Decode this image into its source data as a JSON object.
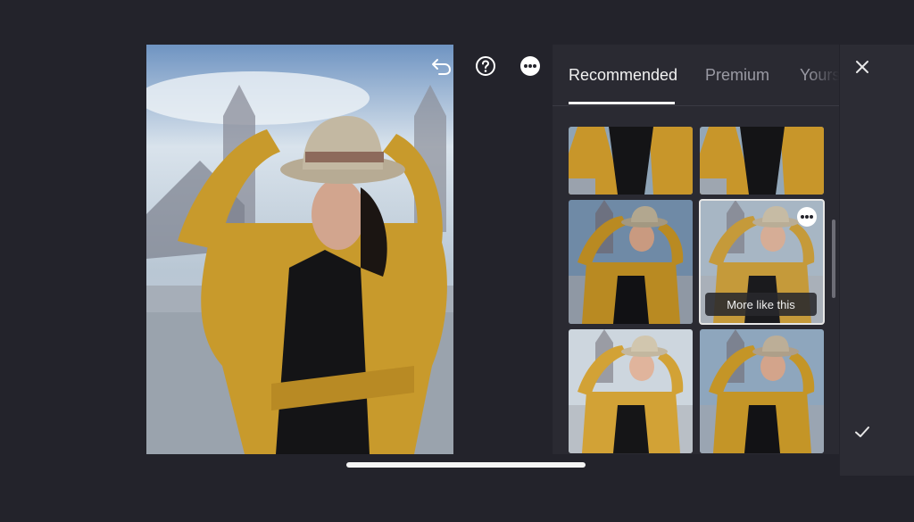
{
  "toolbar": {
    "undo_icon": "undo-icon",
    "help_icon": "help-icon",
    "more_icon": "more-options-icon"
  },
  "panel": {
    "tabs": [
      {
        "label": "Recommended",
        "active": true
      },
      {
        "label": "Premium",
        "active": false
      },
      {
        "label": "Yours",
        "active": false
      }
    ],
    "presets": [
      {
        "id": 1,
        "tone": "warm"
      },
      {
        "id": 2,
        "tone": "warm"
      },
      {
        "id": 3,
        "tone": "cool-contrast"
      },
      {
        "id": 4,
        "tone": "cool-muted",
        "selected": true
      },
      {
        "id": 5,
        "tone": "bright"
      },
      {
        "id": 6,
        "tone": "cool"
      }
    ],
    "more_like_this": "More like this"
  },
  "rail": {
    "close_icon": "close-icon",
    "confirm_icon": "checkmark-icon"
  },
  "colors": {
    "background": "#23232b",
    "panel": "#2a2a32",
    "text_active": "#f2f2f2",
    "text_inactive": "#9a9aa4"
  }
}
